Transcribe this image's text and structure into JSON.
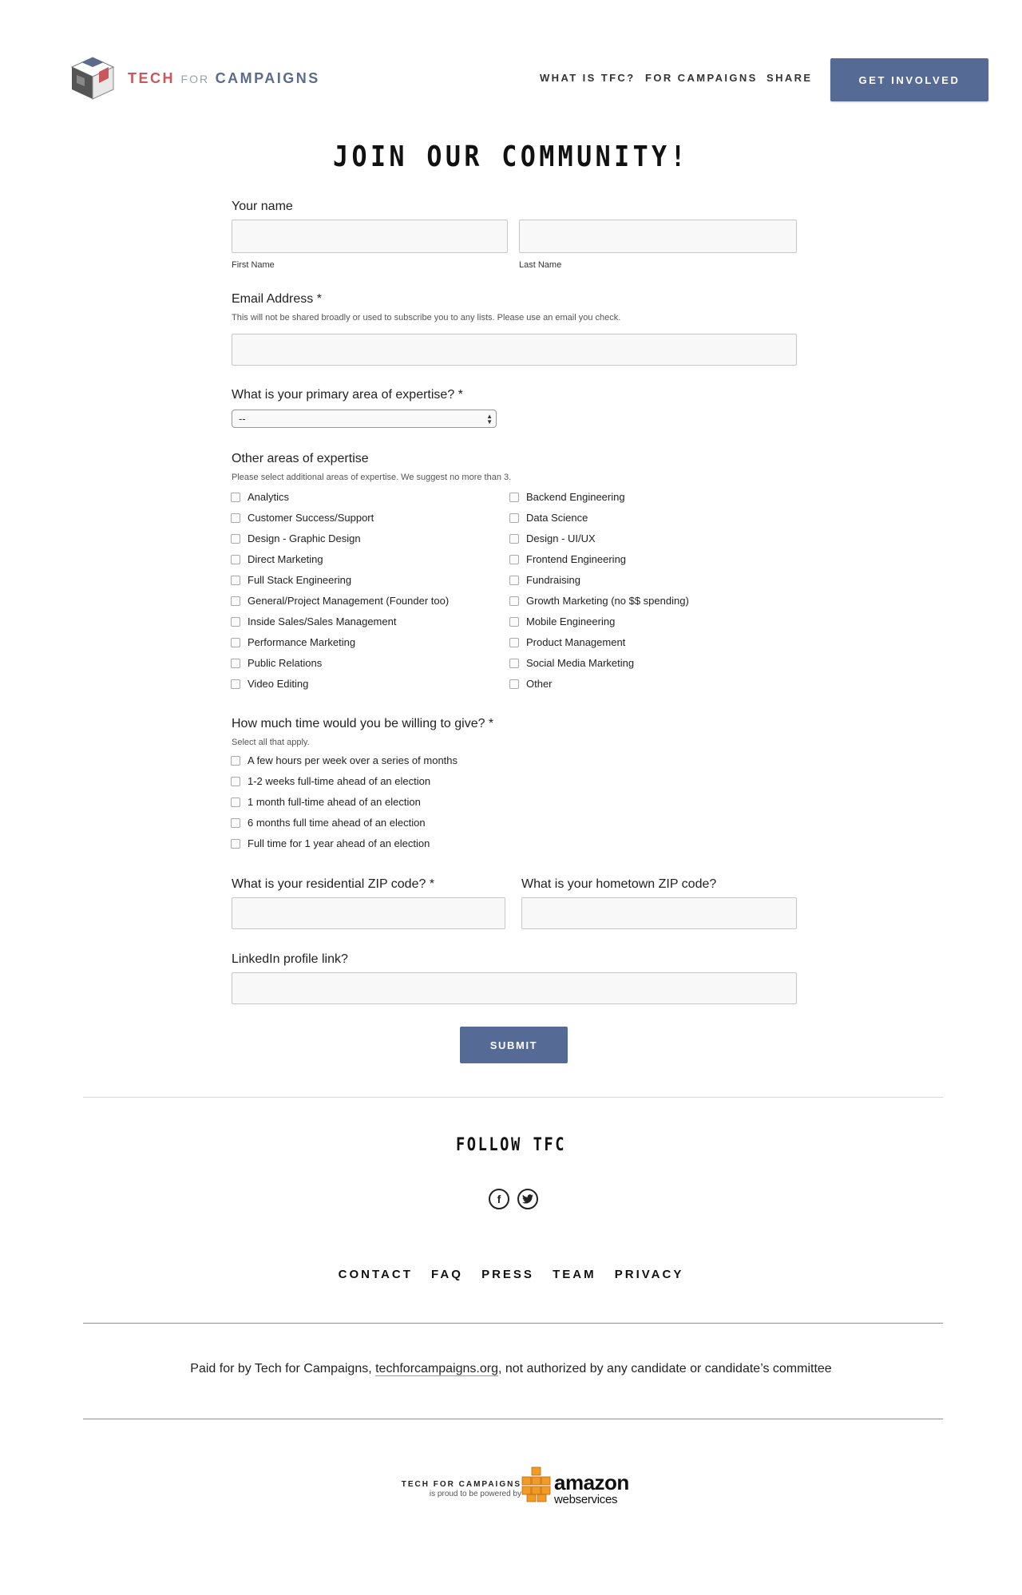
{
  "header": {
    "logo": {
      "tech": "TECH",
      "for": "FOR",
      "campaigns": "CAMPAIGNS"
    },
    "nav": [
      {
        "label": "WHAT IS TFC?"
      },
      {
        "label": "FOR CAMPAIGNS"
      },
      {
        "label": "SHARE"
      }
    ],
    "cta_label": "GET INVOLVED",
    "cta_color": "#566a96"
  },
  "page_title": "JOIN OUR COMMUNITY!",
  "form": {
    "name": {
      "label": "Your name",
      "first_caption": "First Name",
      "last_caption": "Last Name",
      "first_value": "",
      "last_value": ""
    },
    "email": {
      "label": "Email Address *",
      "hint": "This will not be shared broadly or used to subscribe you to any lists. Please use an email you check.",
      "value": ""
    },
    "primary": {
      "label": "What is your primary area of expertise? *",
      "selected": "--"
    },
    "other": {
      "label": "Other areas of expertise",
      "hint": "Please select additional areas of expertise. We suggest no more than 3.",
      "left": [
        "Analytics",
        "Customer Success/Support",
        "Design - Graphic Design",
        "Direct Marketing",
        "Full Stack Engineering",
        "General/Project Management (Founder too)",
        "Inside Sales/Sales Management",
        "Performance Marketing",
        "Public Relations",
        "Video Editing"
      ],
      "right": [
        "Backend Engineering",
        "Data Science",
        "Design - UI/UX",
        "Frontend Engineering",
        "Fundraising",
        "Growth Marketing (no $$ spending)",
        "Mobile Engineering",
        "Product Management",
        "Social Media Marketing",
        "Other"
      ]
    },
    "time": {
      "label": "How much time would you be willing to give? *",
      "hint": "Select all that apply.",
      "options": [
        "A few hours per week over a series of months",
        "1-2 weeks full-time ahead of an election",
        "1 month full-time ahead of an election",
        "6 months full time ahead of an election",
        "Full time for 1 year ahead of an election"
      ]
    },
    "zip": {
      "residential_label": "What is your residential ZIP code? *",
      "hometown_label": "What is your hometown ZIP code?"
    },
    "linkedin": {
      "label": "LinkedIn profile link?"
    },
    "submit_label": "SUBMIT"
  },
  "footer": {
    "follow_title": "FOLLOW TFC",
    "social": [
      {
        "icon": "facebook-icon",
        "glyph": "f"
      },
      {
        "icon": "twitter-icon",
        "glyph": "t"
      }
    ],
    "links": [
      "CONTACT",
      "FAQ",
      "PRESS",
      "TEAM",
      "PRIVACY"
    ],
    "paid_prefix": "Paid for by Tech for Campaigns, ",
    "paid_link": "techforcampaigns.org",
    "paid_suffix": ", not authorized by any candidate or candidate’s committee",
    "aws_line1": "TECH FOR CAMPAIGNS",
    "aws_line2": "is proud to be powered by",
    "aws_amazon": "amazon",
    "aws_ws": "webservices",
    "divider_color": "#d2737a"
  }
}
